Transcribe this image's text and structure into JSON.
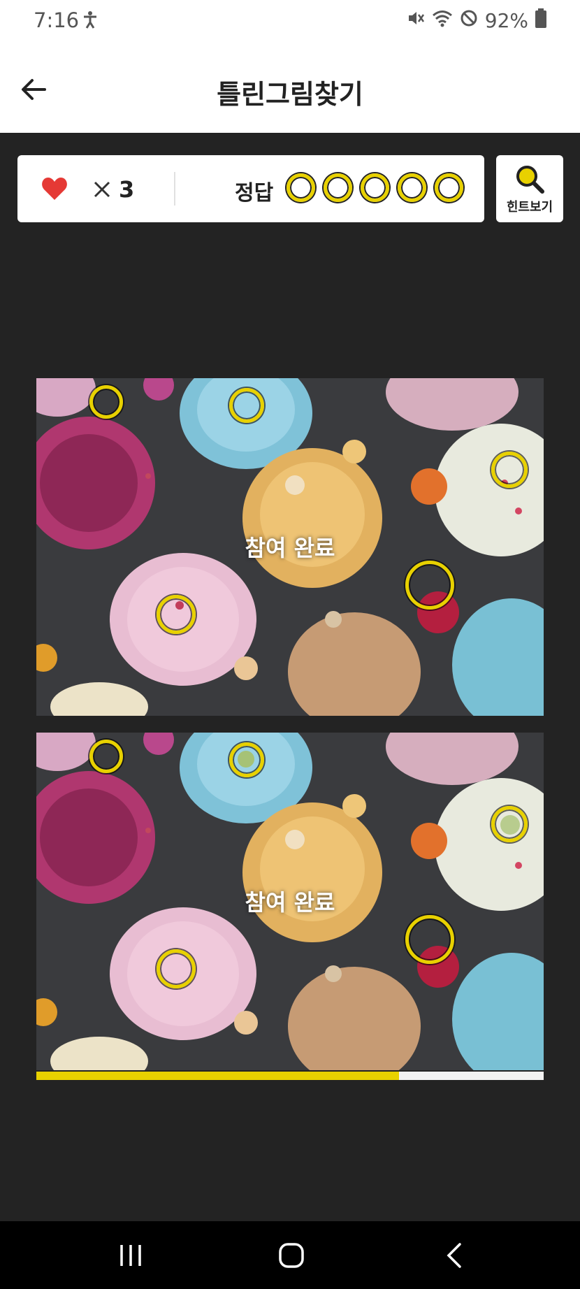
{
  "status_bar": {
    "time": "7:16",
    "battery": "92%",
    "icons": [
      "accessibility-icon",
      "mute-icon",
      "wifi-icon",
      "do-not-disturb-icon",
      "battery-icon"
    ]
  },
  "app_bar": {
    "title": "틀린그림찾기",
    "back_icon": "arrow-left-icon"
  },
  "score": {
    "lives_icon": "heart-icon",
    "times_symbol": "×",
    "lives": "3",
    "answer_label": "정답",
    "answers_total": 5,
    "answers_found": 0
  },
  "hint_button": {
    "label": "힌트보기",
    "icon": "magnifier-icon"
  },
  "puzzles": [
    {
      "overlay_text": "참여 완료"
    },
    {
      "overlay_text": "참여 완료"
    }
  ],
  "progress": {
    "fraction": 0.715
  },
  "colors": {
    "accent": "#e8d100",
    "background": "#232323",
    "heart": "#e53935"
  }
}
